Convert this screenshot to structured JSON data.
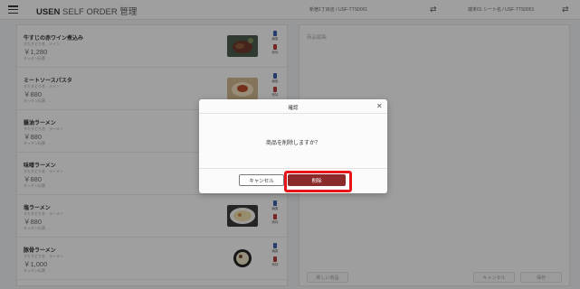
{
  "header": {
    "app_brand": "USEN",
    "app_name": "SELF ORDER 管理",
    "store_info": "新宿1丁目店 / USF-TTS0001",
    "device_info": "端末01 シート名 / USF-TTS0001",
    "menu_icon": "hamburger-icon",
    "swap_icon": "swap-arrows-icon"
  },
  "items": [
    {
      "name": "牛すじの赤ワイン煮込み",
      "category": "すたすどり名　メイン",
      "price": "￥1,280",
      "kitchen": "キッチン伝票　-",
      "edit_label": "編集",
      "delete_label": "削除"
    },
    {
      "name": "ミートソースパスタ",
      "category": "すたすどり名　メイン",
      "price": "￥880",
      "kitchen": "キッチン伝票　-",
      "edit_label": "編集",
      "delete_label": "削除"
    },
    {
      "name": "醤油ラーメン",
      "category": "すたすどり名　ラーメン",
      "price": "￥880",
      "kitchen": "キッチン伝票　-",
      "edit_label": "編集",
      "delete_label": "削除"
    },
    {
      "name": "味噌ラーメン",
      "category": "すたすどり名　ラーメン",
      "price": "￥880",
      "kitchen": "キッチン伝票　-",
      "edit_label": "編集",
      "delete_label": "削除"
    },
    {
      "name": "塩ラーメン",
      "category": "すたすどり名　ラーメン",
      "price": "￥880",
      "kitchen": "キッチン伝票　-",
      "edit_label": "編集",
      "delete_label": "削除"
    },
    {
      "name": "豚骨ラーメン",
      "category": "すたすどり名　ラーメン",
      "price": "￥1,000",
      "kitchen": "キッチン伝票　-",
      "edit_label": "編集",
      "delete_label": "削除"
    }
  ],
  "right_panel": {
    "label": "商品編集",
    "foot_left": "新しい商品",
    "foot_mid": "キャンセル",
    "foot_right": "保存"
  },
  "dialog": {
    "title": "確認",
    "message": "商品を削除しますか？",
    "cancel_label": "キャンセル",
    "delete_label": "削除",
    "close_icon": "close-icon"
  },
  "colors": {
    "delete_button": "#8b2a2a",
    "highlight_border": "#e8141b",
    "edit_icon": "#3a5fa8"
  }
}
